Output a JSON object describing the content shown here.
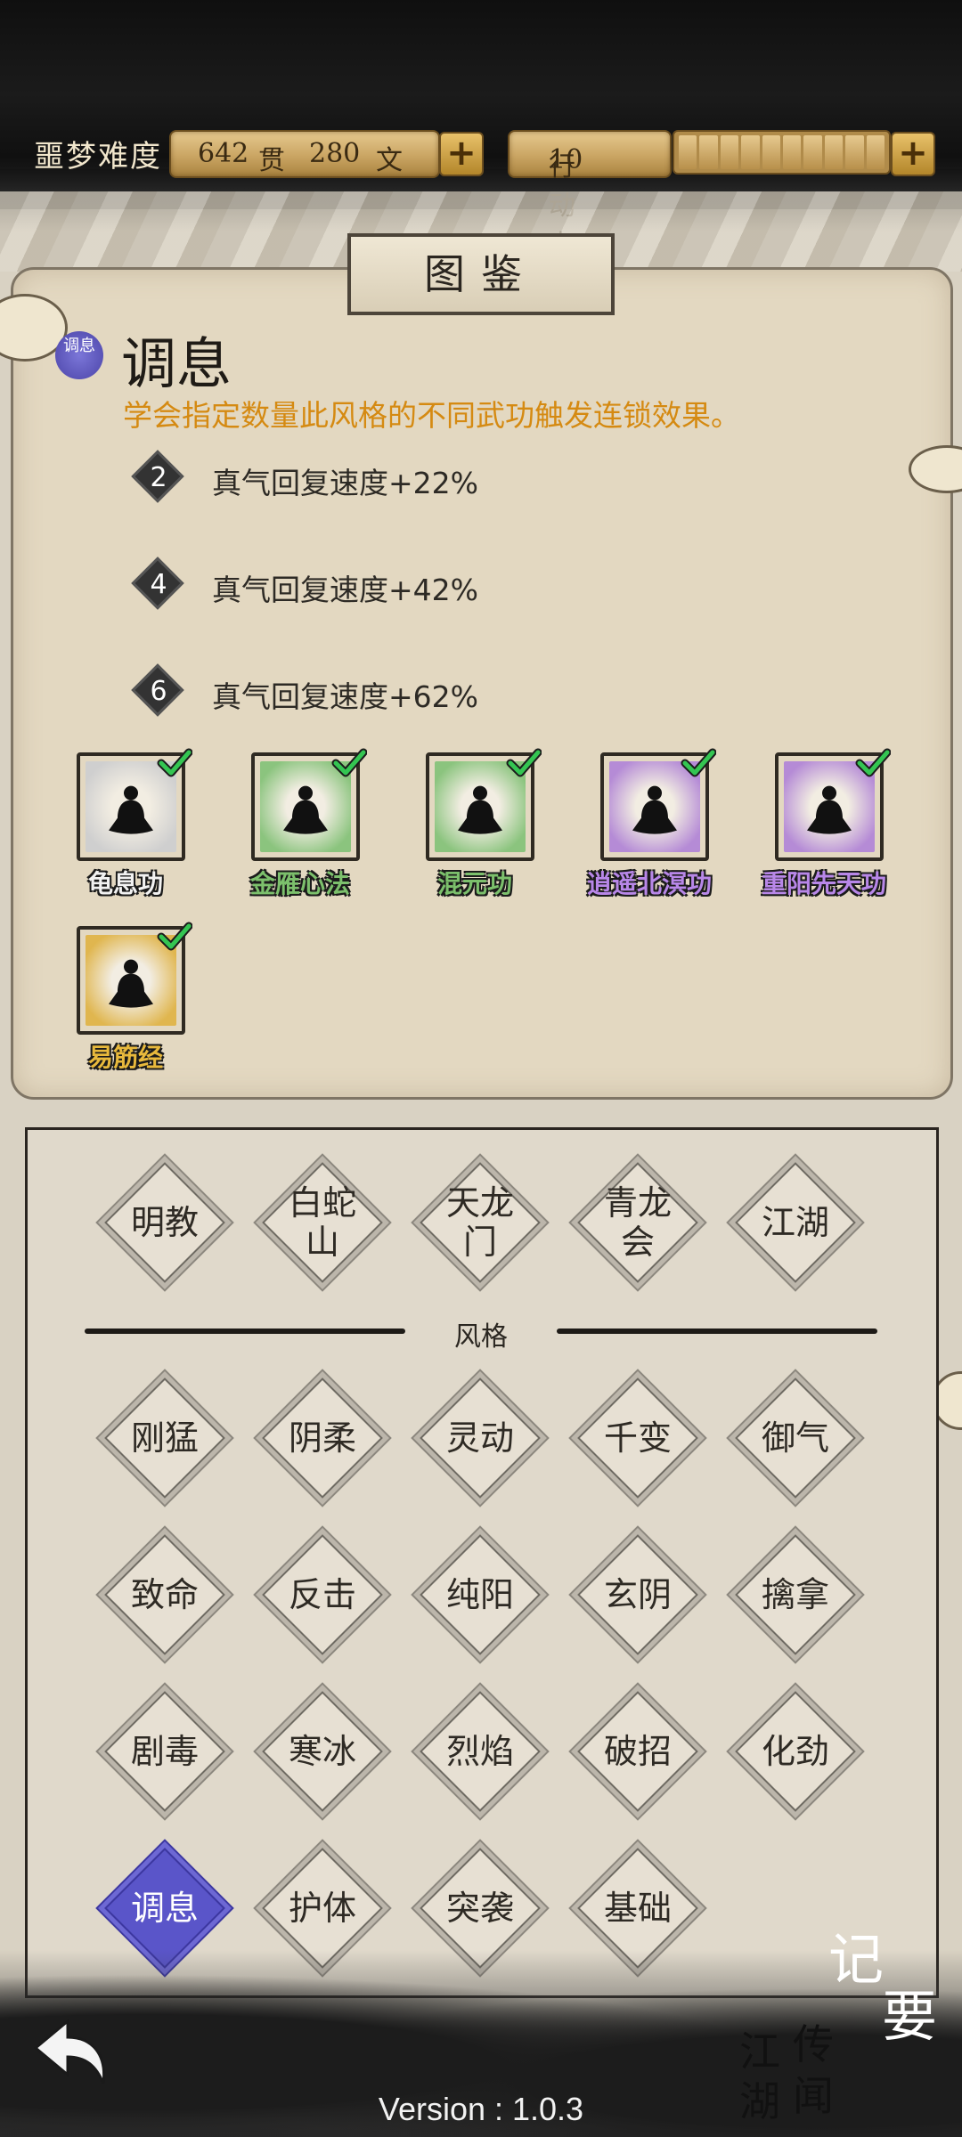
{
  "header": {
    "difficulty": "噩梦难度",
    "money_guan_value": "642",
    "money_guan_unit": "贯",
    "money_wen_value": "280",
    "money_wen_unit": "文",
    "action_label": "行动力",
    "action_value": "10",
    "action_cells": 10,
    "plus_glyph": "+"
  },
  "panel": {
    "tab_title": "图鉴",
    "badge_text": "调息",
    "style_title": "调息",
    "description": "学会指定数量此风格的不同武功触发连锁效果。",
    "tiers": [
      {
        "count": "2",
        "effect": "真气回复速度+22%"
      },
      {
        "count": "4",
        "effect": "真气回复速度+42%"
      },
      {
        "count": "6",
        "effect": "真气回复速度+62%"
      }
    ],
    "skills": [
      {
        "name": "龟息功",
        "rarity_color": "#cfcfcf",
        "name_color": "#f2f2f2",
        "learned": true
      },
      {
        "name": "金雁心法",
        "rarity_color": "#8bc47e",
        "name_color": "#7cc06c",
        "learned": true
      },
      {
        "name": "混元功",
        "rarity_color": "#8bc47e",
        "name_color": "#7cc06c",
        "learned": true
      },
      {
        "name": "逍遥北溟功",
        "rarity_color": "#b58bd6",
        "name_color": "#b887e8",
        "learned": true
      },
      {
        "name": "重阳先天功",
        "rarity_color": "#b58bd6",
        "name_color": "#b887e8",
        "learned": true
      },
      {
        "name": "易筋经",
        "rarity_color": "#e0b64f",
        "name_color": "#e8b93c",
        "learned": true
      }
    ]
  },
  "factions": [
    "明教",
    "白蛇山",
    "天龙门",
    "青龙会",
    "江湖"
  ],
  "style_divider": "风格",
  "styles": [
    "刚猛",
    "阴柔",
    "灵动",
    "千变",
    "御气",
    "致命",
    "反击",
    "纯阳",
    "玄阴",
    "擒拿",
    "剧毒",
    "寒冰",
    "烈焰",
    "破招",
    "化劲",
    "调息",
    "护体",
    "突袭",
    "基础"
  ],
  "active_style": "调息",
  "footer": {
    "jiyao_1": "记",
    "jiyao_2": "要",
    "jianghu_1": "江",
    "jianghu_2": "湖",
    "jianghu_3": "传",
    "jianghu_4": "闻",
    "version": "Version : 1.0.3"
  },
  "colors": {
    "accent": "#5a55c9",
    "description_text": "#d58a12"
  }
}
